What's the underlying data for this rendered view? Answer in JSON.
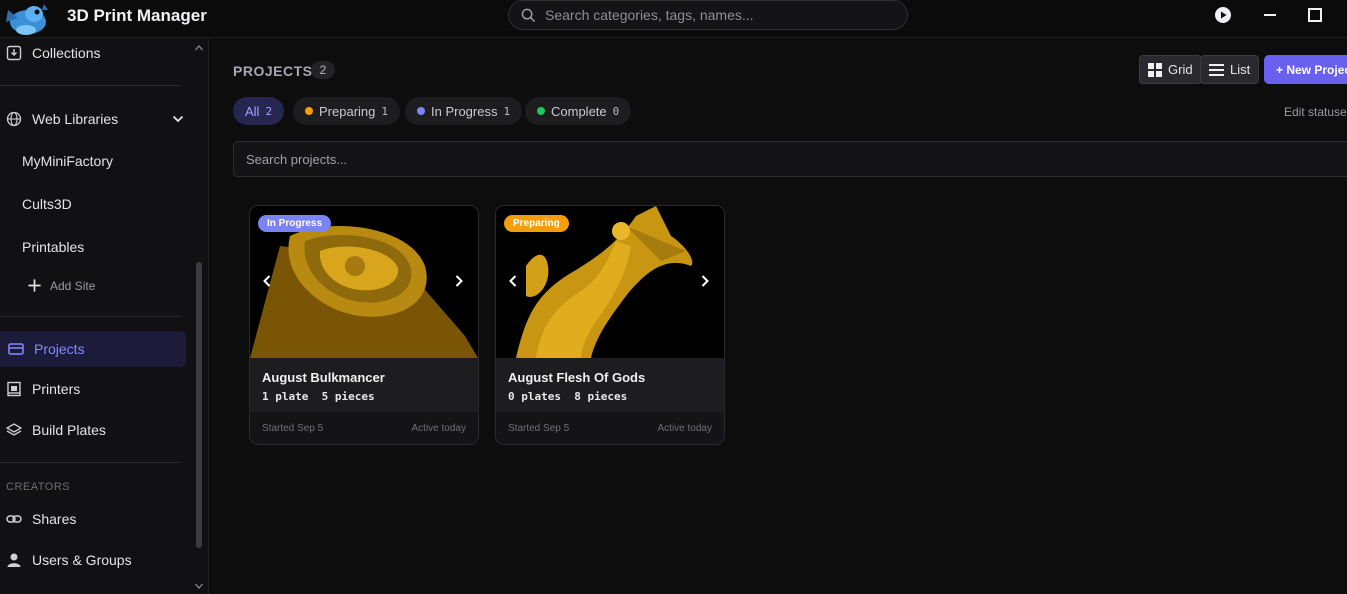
{
  "app": {
    "title": "3D Print Manager"
  },
  "global_search": {
    "placeholder": "Search categories, tags, names..."
  },
  "sidebar": {
    "items": [
      {
        "label": "Collections",
        "icon": "download-box-icon"
      },
      {
        "label": "Web Libraries",
        "icon": "globe-icon"
      },
      {
        "label": "MyMiniFactory"
      },
      {
        "label": "Cults3D"
      },
      {
        "label": "Printables"
      },
      {
        "label": "Add Site",
        "icon": "plus-icon"
      },
      {
        "label": "Projects",
        "icon": "card-icon"
      },
      {
        "label": "Printers",
        "icon": "printer-icon"
      },
      {
        "label": "Build Plates",
        "icon": "layers-icon"
      },
      {
        "label": "Shares",
        "icon": "link-icon"
      },
      {
        "label": "Users & Groups",
        "icon": "user-icon"
      }
    ],
    "creators_label": "CREATORS"
  },
  "main": {
    "title": "PROJECTS",
    "count": "2",
    "view_grid_label": "Grid",
    "view_list_label": "List",
    "new_project_label": "+ New Project",
    "edit_statuses_label": "Edit statuses",
    "filters": [
      {
        "label": "All",
        "count": "2",
        "color": ""
      },
      {
        "label": "Preparing",
        "count": "1",
        "color": "#f59e0b"
      },
      {
        "label": "In Progress",
        "count": "1",
        "color": "#7b83f5"
      },
      {
        "label": "Complete",
        "count": "0",
        "color": "#22c55e"
      }
    ],
    "search_placeholder": "Search projects...",
    "projects": [
      {
        "status": "In Progress",
        "status_color": "#7b83f5",
        "name": "August Bulkmancer",
        "meta": "1 plate  5 pieces",
        "started": "Started Sep 5",
        "activity": "Active today"
      },
      {
        "status": "Preparing",
        "status_color": "#f59e0b",
        "name": "August Flesh Of Gods",
        "meta": "0 plates  8 pieces",
        "started": "Started Sep 5",
        "activity": "Active today"
      }
    ]
  },
  "colors": {
    "accent": "#6a60f0",
    "background": "#0d0d0e",
    "sidebar_active": "#1c1c3a"
  }
}
